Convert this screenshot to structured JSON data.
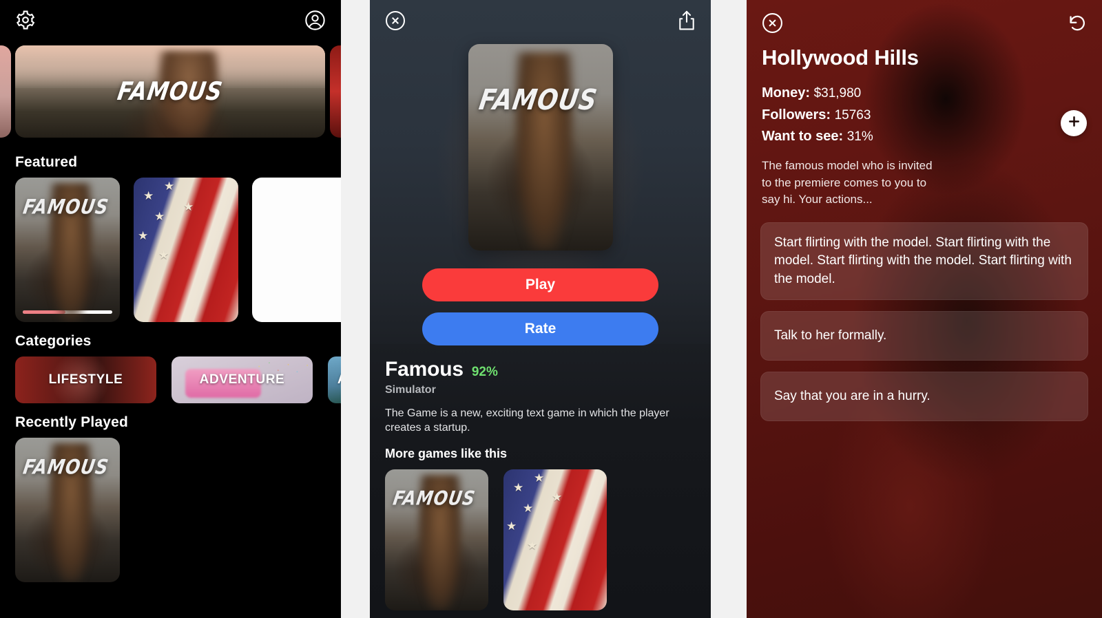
{
  "home": {
    "topbar": {
      "settings_icon": "gear-icon",
      "profile_icon": "avatar-icon"
    },
    "hero": {
      "wordmark": "FAMOUS"
    },
    "sections": {
      "featured": "Featured",
      "categories": "Categories",
      "recently_played": "Recently Played"
    },
    "featured_cards": [
      {
        "wordmark": "FAMOUS",
        "progress_percent": 48
      },
      {
        "wordmark": ""
      },
      {
        "wordmark": ""
      }
    ],
    "categories": [
      {
        "label": "LIFESTYLE"
      },
      {
        "label": "ADVENTURE"
      },
      {
        "label": "A"
      }
    ],
    "recent_cards": [
      {
        "wordmark": "FAMOUS"
      }
    ]
  },
  "detail": {
    "topbar": {
      "close_icon": "close-circle-icon",
      "share_icon": "share-icon"
    },
    "cover": {
      "wordmark": "FAMOUS"
    },
    "buttons": {
      "play": "Play",
      "rate": "Rate"
    },
    "title": "Famous",
    "score": "92%",
    "genre": "Simulator",
    "description": "The Game is a new, exciting text game in which the player creates a startup.",
    "more_title": "More games like this",
    "more_cards": [
      {
        "wordmark": "FAMOUS"
      },
      {
        "wordmark": ""
      }
    ]
  },
  "story": {
    "topbar": {
      "close_icon": "close-circle-icon",
      "undo_icon": "undo-icon"
    },
    "title": "Hollywood Hills",
    "stats": [
      {
        "label": "Money:",
        "value": "$31,980"
      },
      {
        "label": "Followers:",
        "value": "15763"
      },
      {
        "label": "Want to see:",
        "value": "31%"
      }
    ],
    "narrative": "The famous model who is invited to the premiere comes to you to say hi. Your actions...",
    "add_button_icon": "plus-icon",
    "choices": [
      "Start flirting with the model. Start flirting with the model. Start flirting with the model. Start flirting with the model.",
      "Talk to her formally.",
      "Say that you are in a hurry."
    ]
  },
  "colors": {
    "play_button": "#fa3b3b",
    "rate_button": "#3d7cf0",
    "score_green": "#6fe06f",
    "story_background": "#5c1511",
    "detail_background": "#2b333d",
    "home_background": "#000000",
    "progress_fill": "#ec7f84"
  }
}
